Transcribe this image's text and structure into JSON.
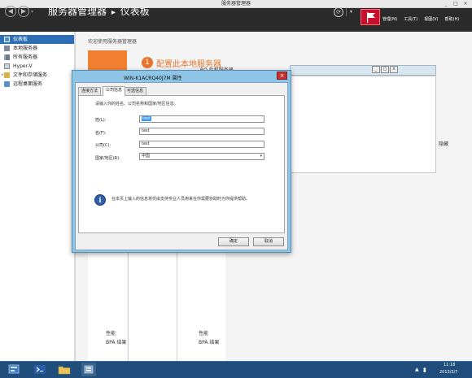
{
  "window": {
    "title": "服务器管理器",
    "controls": [
      "_",
      "□",
      "×"
    ]
  },
  "header": {
    "breadcrumb_app": "服务器管理器",
    "breadcrumb_sep": "▸",
    "breadcrumb_page": "仪表板",
    "menus": [
      "管理(M)",
      "工具(T)",
      "视图(V)",
      "帮助(H)"
    ]
  },
  "sidebar": {
    "items": [
      {
        "label": "仪表板",
        "icon": "dashboard-icon",
        "selected": true
      },
      {
        "label": "本地服务器",
        "icon": "server-icon"
      },
      {
        "label": "所有服务器",
        "icon": "servers-icon"
      },
      {
        "label": "Hyper-V",
        "icon": "hyperv-icon"
      },
      {
        "label": "文件和存储服务",
        "icon": "storage-icon",
        "expandable": true
      },
      {
        "label": "远程桌面服务",
        "icon": "remote-desktop-icon"
      }
    ]
  },
  "main": {
    "welcome": "欢迎使用服务器管理器",
    "quickstart_step": "1",
    "quickstart_title": "配置此本地服务器",
    "quickstart_line": "RO 此机服务器",
    "hide_link": "隐藏",
    "tile_left": [
      "性能",
      "BPA 结果"
    ],
    "tile_right": [
      "性能",
      "BPA 结果"
    ]
  },
  "dialog": {
    "title": "WIN-K1ACRQ40J7M 属性",
    "close": "×",
    "tabs": [
      "连接方法",
      "公司信息",
      "可选信息"
    ],
    "active_tab": 1,
    "instruction": "请输入你的姓名、公司名称和国家/地区信息。",
    "fields": [
      {
        "label": "姓(L):",
        "value": "test",
        "selected": true
      },
      {
        "label": "名(F):",
        "value": "test"
      },
      {
        "label": "公司(C):",
        "value": "test"
      },
      {
        "label": "国家/地区(R):",
        "value": "中国",
        "type": "select"
      }
    ],
    "info_text": "在本页上输入的信息将仅由支持专业人员用来在你需要协助时为你提供帮助。",
    "ok": "确定",
    "cancel": "取消"
  },
  "taskbar": {
    "time": "11:18",
    "date": "2013/3/7",
    "tray_arrow": "▲",
    "tray_network": "▮"
  },
  "colors": {
    "header_bg": "#2b2b2b",
    "sidebar_selected": "#2d6fb6",
    "accent_orange": "#e8742a",
    "dialog_frame": "#8ec4e6",
    "taskbar": "#1f4e7d",
    "flag_red": "#c8102e"
  }
}
